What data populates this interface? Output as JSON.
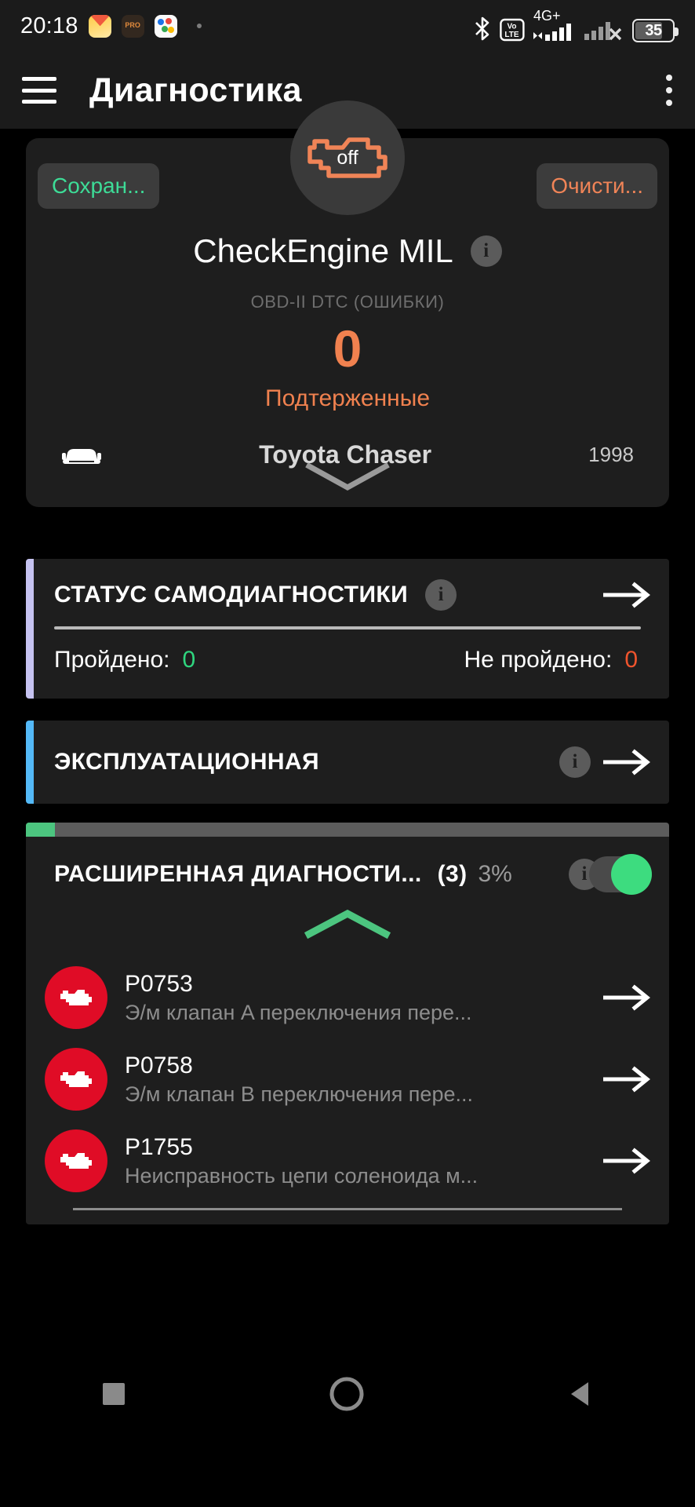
{
  "statusbar": {
    "time": "20:18",
    "icons": [
      "mail-icon",
      "pro-camera-icon",
      "photos-icon",
      "dot-indicator"
    ],
    "network_label": "4G+",
    "volte_label_top": "Vo",
    "volte_label_bottom": "LTE",
    "battery_level": "35"
  },
  "appbar": {
    "menu_icon": "hamburger-icon",
    "title": "Диагностика",
    "overflow_icon": "kebab-menu-icon"
  },
  "mil_card": {
    "badge_label": "off",
    "save_button": "Сохран...",
    "clear_button": "Очисти...",
    "title": "CheckEngine MIL",
    "info_glyph": "i",
    "subtitle": "OBD-II DTC (ОШИБКИ)",
    "count": "0",
    "count_label": "Подтерженные",
    "vehicle_icon": "car-icon",
    "vehicle_name": "Toyota Chaser",
    "vehicle_year": "1998",
    "collapse_icon": "chevron-down-icon"
  },
  "sections": [
    {
      "id": "self-diagnostics",
      "title": "СТАТУС САМОДИАГНОСТИКИ",
      "accent": "#c5c2f0",
      "info_glyph": "i",
      "arrow_icon": "arrow-right-icon",
      "passed_label": "Пройдено:",
      "passed_value": "0",
      "failed_label": "Не пройдено:",
      "failed_value": "0"
    },
    {
      "id": "operational",
      "title": "ЭКСПЛУАТАЦИОННАЯ",
      "accent": "#54b9f7",
      "info_glyph": "i",
      "arrow_icon": "arrow-right-icon"
    }
  ],
  "advanced": {
    "accent": "#4cc57f",
    "title": "РАСШИРЕННАЯ ДИАГНОСТИ...",
    "count": "(3)",
    "percent": "3%",
    "progress_value": 3,
    "info_glyph": "i",
    "toggle_on": true,
    "collapse_icon": "chevron-up-icon",
    "dtc_items": [
      {
        "icon": "check-engine-icon",
        "code": "P0753",
        "description": "Э/м клапан A переключения пере...",
        "arrow_icon": "arrow-right-icon"
      },
      {
        "icon": "check-engine-icon",
        "code": "P0758",
        "description": "Э/м клапан B переключения пере...",
        "arrow_icon": "arrow-right-icon"
      },
      {
        "icon": "check-engine-icon",
        "code": "P1755",
        "description": "Неисправность цепи соленоида м...",
        "arrow_icon": "arrow-right-icon"
      }
    ]
  },
  "navbar": {
    "recents_icon": "square-icon",
    "home_icon": "circle-icon",
    "back_icon": "triangle-back-icon"
  },
  "colors": {
    "orange": "#f0814f",
    "green": "#3ddc97",
    "red": "#e00c26",
    "card": "#1e1e1e",
    "background": "#000000"
  }
}
